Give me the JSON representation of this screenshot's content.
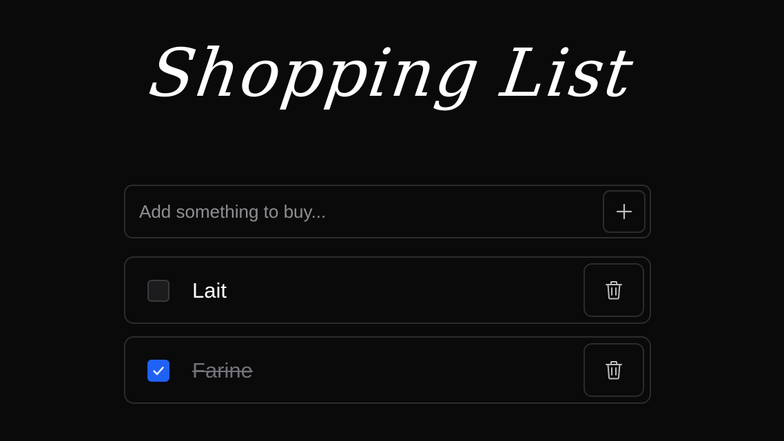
{
  "header": {
    "title": "Shopping List"
  },
  "add_form": {
    "placeholder": "Add something to buy...",
    "value": "",
    "add_icon": "plus-icon"
  },
  "items": [
    {
      "label": "Lait",
      "checked": false,
      "delete_icon": "trash-icon"
    },
    {
      "label": "Farine",
      "checked": true,
      "delete_icon": "trash-icon"
    }
  ],
  "colors": {
    "background": "#0a0a0a",
    "border": "#2c2c2e",
    "accent": "#1f62f5",
    "text": "#ffffff",
    "muted_text": "#71727a",
    "placeholder": "#8e8e93"
  }
}
